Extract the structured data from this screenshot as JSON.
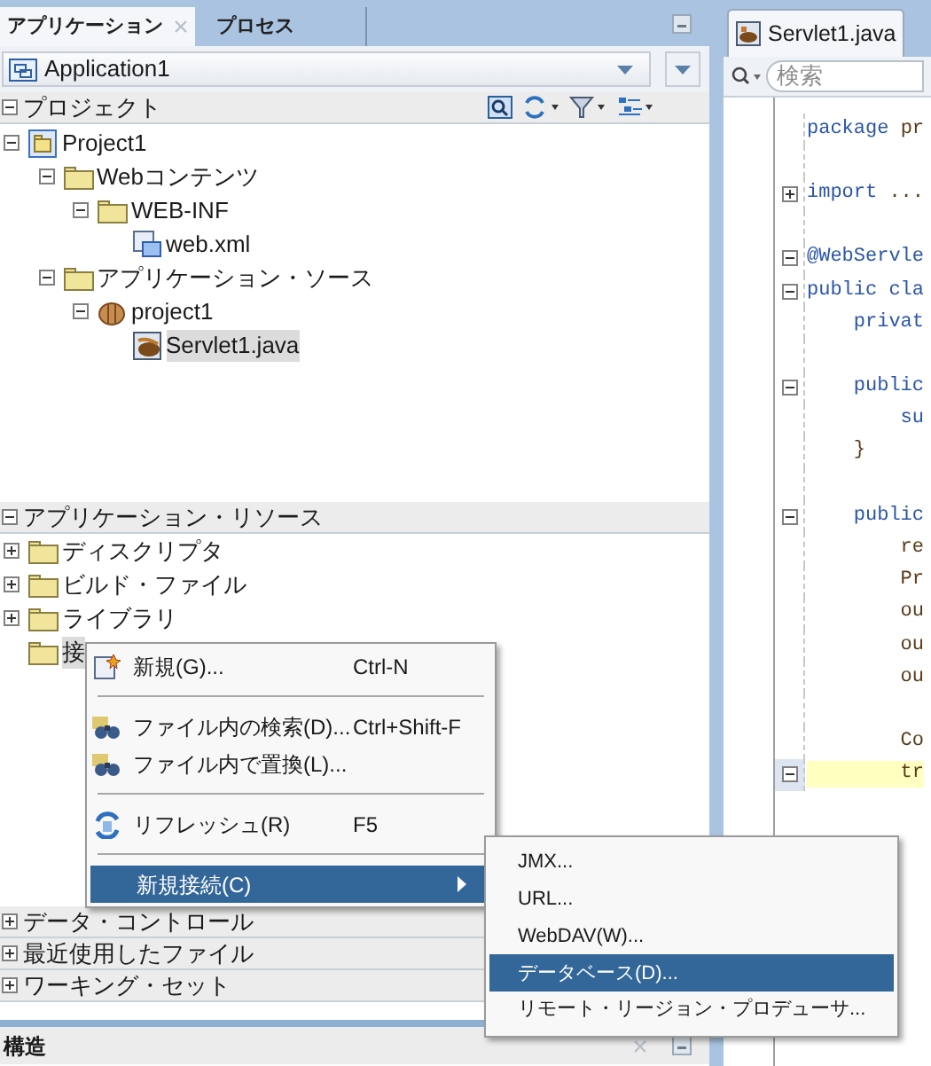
{
  "left_panel": {
    "tabs": [
      {
        "label": "アプリケーション",
        "selected": true,
        "closable": true
      },
      {
        "label": "プロセス",
        "selected": false,
        "closable": false
      }
    ],
    "application_selector": {
      "value": "Application1"
    },
    "project_section": {
      "title": "プロジェクト",
      "expanded": true,
      "tree": [
        {
          "label": "Project1",
          "kind": "project",
          "expanded": true,
          "selected": false,
          "children": [
            {
              "label": "Webコンテンツ",
              "kind": "folder",
              "expanded": true,
              "selected": false,
              "children": [
                {
                  "label": "WEB-INF",
                  "kind": "folder",
                  "expanded": true,
                  "selected": false,
                  "children": [
                    {
                      "label": "web.xml",
                      "kind": "xml",
                      "selected": false
                    }
                  ]
                }
              ]
            },
            {
              "label": "アプリケーション・ソース",
              "kind": "folder",
              "expanded": true,
              "selected": false,
              "children": [
                {
                  "label": "project1",
                  "kind": "package",
                  "expanded": true,
                  "selected": false,
                  "children": [
                    {
                      "label": "Servlet1.java",
                      "kind": "java",
                      "selected": true
                    }
                  ]
                }
              ]
            }
          ]
        }
      ]
    },
    "resources_section": {
      "title": "アプリケーション・リソース",
      "expanded": true,
      "tree": [
        {
          "label": "ディスクリプタ",
          "kind": "folder",
          "expanded": false,
          "selected": false
        },
        {
          "label": "ビルド・ファイル",
          "kind": "folder",
          "expanded": false,
          "selected": false
        },
        {
          "label": "ライブラリ",
          "kind": "folder",
          "expanded": false,
          "selected": false
        },
        {
          "label": "接",
          "kind": "folder",
          "selected": true
        }
      ]
    },
    "collapsed_sections": [
      {
        "title": "データ・コントロール",
        "expanded": false
      },
      {
        "title": "最近使用したファイル",
        "expanded": false
      },
      {
        "title": "ワーキング・セット",
        "expanded": false
      }
    ],
    "structure_panel": {
      "title": "構造"
    }
  },
  "editor": {
    "tab": {
      "label": "Servlet1.java"
    },
    "search": {
      "placeholder": "検索"
    },
    "lines": [
      {
        "kind": "code",
        "tokens": [
          {
            "text": "package",
            "kind": "keyword"
          },
          {
            "text": " pr",
            "kind": "plain"
          }
        ]
      },
      {
        "kind": "blank"
      },
      {
        "kind": "code",
        "folded": true,
        "tokens": [
          {
            "text": "import",
            "kind": "keyword"
          },
          {
            "text": " ...",
            "kind": "plain"
          }
        ]
      },
      {
        "kind": "blank"
      },
      {
        "kind": "code",
        "folded": false,
        "tokens": [
          {
            "text": "@WebServle",
            "kind": "keyword"
          }
        ]
      },
      {
        "kind": "code",
        "folded": false,
        "tokens": [
          {
            "text": "public cla",
            "kind": "keyword"
          }
        ]
      },
      {
        "kind": "code",
        "tokens": [
          {
            "text": "    privat",
            "kind": "keyword"
          }
        ]
      },
      {
        "kind": "blank"
      },
      {
        "kind": "code",
        "folded": false,
        "tokens": [
          {
            "text": "    public",
            "kind": "keyword"
          }
        ]
      },
      {
        "kind": "code",
        "tokens": [
          {
            "text": "        su",
            "kind": "keyword"
          }
        ]
      },
      {
        "kind": "code",
        "tokens": [
          {
            "text": "    }",
            "kind": "plain"
          }
        ]
      },
      {
        "kind": "blank"
      },
      {
        "kind": "code",
        "folded": false,
        "tokens": [
          {
            "text": "    public",
            "kind": "keyword"
          }
        ]
      },
      {
        "kind": "code",
        "tokens": [
          {
            "text": "        re",
            "kind": "plain"
          }
        ]
      },
      {
        "kind": "code",
        "tokens": [
          {
            "text": "        Pr",
            "kind": "plain"
          }
        ]
      },
      {
        "kind": "code",
        "tokens": [
          {
            "text": "        ou",
            "kind": "plain"
          }
        ]
      },
      {
        "kind": "code",
        "tokens": [
          {
            "text": "        ou",
            "kind": "plain"
          }
        ]
      },
      {
        "kind": "code",
        "tokens": [
          {
            "text": "        ou",
            "kind": "plain"
          }
        ]
      },
      {
        "kind": "blank"
      },
      {
        "kind": "code",
        "tokens": [
          {
            "text": "        Co",
            "kind": "plain"
          }
        ]
      },
      {
        "kind": "code",
        "folded": false,
        "highlight": true,
        "tokens": [
          {
            "text": "        tr",
            "kind": "plain"
          }
        ]
      }
    ]
  },
  "context_menu": {
    "items": [
      {
        "kind": "new",
        "label": "新規(G)...",
        "shortcut": "Ctrl-N",
        "selected": false
      },
      {
        "kind": "separator"
      },
      {
        "kind": "find",
        "label": "ファイル内の検索(D)...",
        "shortcut": "Ctrl+Shift-F",
        "selected": false
      },
      {
        "kind": "find",
        "label": "ファイル内で置換(L)...",
        "selected": false
      },
      {
        "kind": "separator"
      },
      {
        "kind": "refresh",
        "label": "リフレッシュ(R)",
        "shortcut": "F5",
        "selected": false
      },
      {
        "kind": "separator"
      },
      {
        "kind": "submenu",
        "label": "新規接続(C)",
        "selected": true
      }
    ]
  },
  "submenu": {
    "items": [
      {
        "label": "JMX...",
        "selected": false
      },
      {
        "label": "URL...",
        "selected": false
      },
      {
        "label": "WebDAV(W)...",
        "selected": false
      },
      {
        "label": "データベース(D)...",
        "selected": true
      },
      {
        "label": "リモート・リージョン・プロデューサ...",
        "selected": false
      }
    ]
  }
}
